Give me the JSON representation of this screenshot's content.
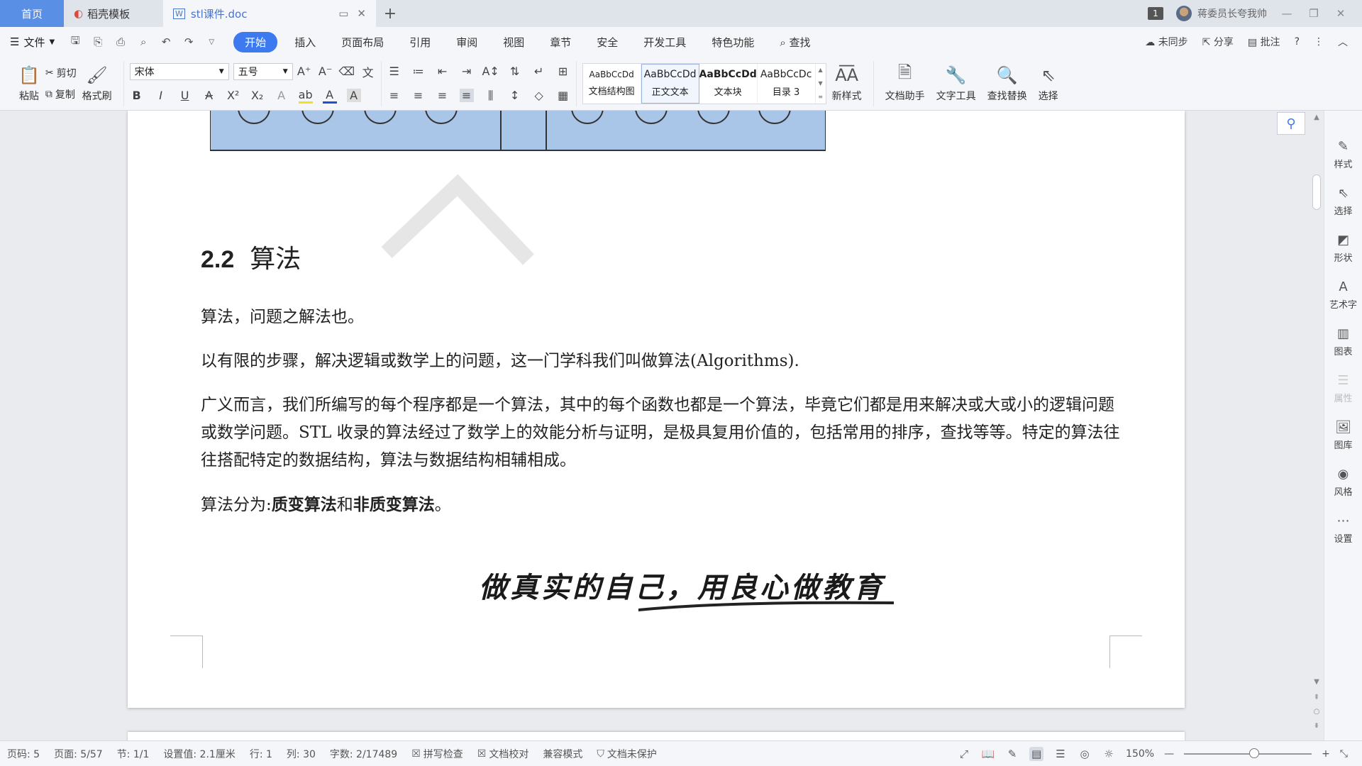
{
  "tabs": {
    "home": "首页",
    "template": "稻壳模板",
    "document": "stl课件.doc"
  },
  "titlebar": {
    "window_count": "1",
    "user_name": "蒋委员长夸我帅"
  },
  "menu": {
    "file": "文件",
    "items": [
      "开始",
      "插入",
      "页面布局",
      "引用",
      "审阅",
      "视图",
      "章节",
      "安全",
      "开发工具",
      "特色功能"
    ],
    "search": "查找",
    "sync": "未同步",
    "share": "分享",
    "comment": "批注"
  },
  "ribbon": {
    "paste": "粘贴",
    "cut": "剪切",
    "copy": "复制",
    "format_painter": "格式刷",
    "font_name": "宋体",
    "font_size": "五号",
    "styles": [
      {
        "sample": "AaBbCcDd",
        "label": "文档结构图"
      },
      {
        "sample": "AaBbCcDd",
        "label": "正文文本"
      },
      {
        "sample": "AaBbCcDd",
        "label": "文本块"
      },
      {
        "sample": "AaBbCcDc",
        "label": "目录 3"
      }
    ],
    "new_style": "新样式",
    "doc_assistant": "文档助手",
    "text_tools": "文字工具",
    "find_replace": "查找替换",
    "select": "选择"
  },
  "document": {
    "heading_number": "2.2",
    "heading_text": "算法",
    "para1": "算法，问题之解法也。",
    "para2": "以有限的步骤，解决逻辑或数学上的问题，这一门学科我们叫做算法(Algorithms).",
    "para3": "广义而言，我们所编写的每个程序都是一个算法，其中的每个函数也都是一个算法，毕竟它们都是用来解决或大或小的逻辑问题或数学问题。STL 收录的算法经过了数学上的效能分析与证明，是极具复用价值的，包括常用的排序，查找等等。特定的算法往往搭配特定的数据结构，算法与数据结构相辅相成。",
    "para4_prefix": "算法分为:",
    "para4_bold1": "质变算法",
    "para4_mid": "和",
    "para4_bold2": "非质变算法",
    "para4_suffix": "。",
    "slogan": "做真实的自己，用良心做教育"
  },
  "sidebar": [
    "样式",
    "选择",
    "形状",
    "艺术字",
    "图表",
    "属性",
    "图库",
    "风格",
    "设置"
  ],
  "status": {
    "page_code": "页码: 5",
    "page": "页面: 5/57",
    "section": "节: 1/1",
    "setting": "设置值: 2.1厘米",
    "row": "行: 1",
    "col": "列: 30",
    "words": "字数: 2/17489",
    "spell_check": "拼写检查",
    "proofread": "文档校对",
    "compat": "兼容模式",
    "protect": "文档未保护",
    "zoom": "150%"
  },
  "colors": {
    "accent": "#3d7af0",
    "home_tab": "#5a8fe6",
    "diagram_fill": "#a9c6e8"
  }
}
